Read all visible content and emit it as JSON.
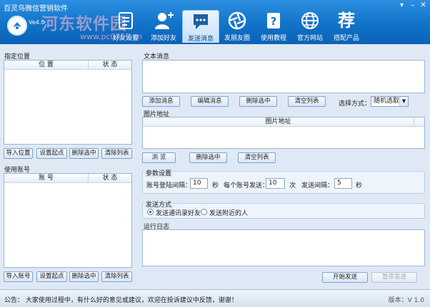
{
  "window": {
    "title": "百灵鸟微信营销软件",
    "logo_small_text": "Ve4.0",
    "watermark_main": "河东软件园",
    "watermark_url": "www.pc0359.cn"
  },
  "toolbar": {
    "items": [
      {
        "label": "好友设置",
        "icon": "settings-card-icon"
      },
      {
        "label": "添加好友",
        "icon": "add-user-icon"
      },
      {
        "label": "发送消息",
        "icon": "chat-bubble-icon",
        "active": true
      },
      {
        "label": "发朋友圈",
        "icon": "camera-shutter-icon"
      },
      {
        "label": "使用教程",
        "icon": "help-doc-icon"
      },
      {
        "label": "官方网站",
        "icon": "globe-icon"
      },
      {
        "label": "搭配产品",
        "icon": "recommend-char-icon",
        "char": "荐"
      }
    ]
  },
  "location": {
    "group_title": "指定位置",
    "columns": [
      "位  置",
      "状  态"
    ],
    "buttons": [
      "导入位置",
      "设置起点",
      "删除选中",
      "清除列表"
    ]
  },
  "accounts": {
    "group_title": "使用账号",
    "columns": [
      "账  号",
      "状  态"
    ],
    "buttons": [
      "导入账号",
      "设置起点",
      "删除选中",
      "清除列表"
    ]
  },
  "text_message": {
    "group_title": "文本消息",
    "buttons": [
      "添加消息",
      "编辑消息",
      "删除选中",
      "清空列表"
    ],
    "select_label": "选择方式：",
    "select_value": "随机选取"
  },
  "images": {
    "group_title": "图片地址",
    "column": "图片地址",
    "buttons": [
      "浏  览",
      "删除选中",
      "清空列表"
    ]
  },
  "params": {
    "group_title": "参数设置",
    "login_interval_label": "账号登陆间隔：",
    "login_interval_value": "10",
    "login_interval_unit": "秒",
    "per_account_label": "每个账号发送：",
    "per_account_value": "10",
    "per_account_unit": "次",
    "send_interval_label": "发送间隔：",
    "send_interval_value": "5",
    "send_interval_unit": "秒"
  },
  "send_mode": {
    "group_title": "发送方式",
    "options": [
      "发送通讯录好友",
      "发送附近的人"
    ],
    "selected_index": 0
  },
  "log": {
    "group_title": "运行日志",
    "start_button": "开始发送",
    "pause_button": "暂停发送"
  },
  "statusbar": {
    "notice": "公告：  大家使用过程中，有什么好的意见或建议，欢迎在投诉建议中反馈，谢谢！",
    "version": "版本：V 1.0"
  }
}
